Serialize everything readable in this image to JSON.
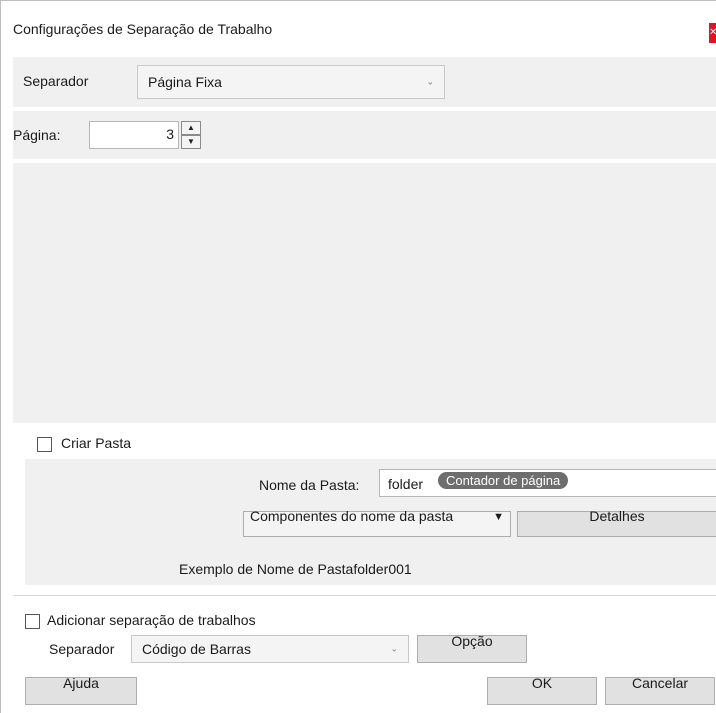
{
  "window": {
    "title": "Configurações de Separação de Trabalho",
    "close_label": "✕"
  },
  "separator": {
    "label": "Separador",
    "value": "Página Fixa"
  },
  "page": {
    "label": "Página:",
    "value": "3"
  },
  "create_folder": {
    "label": "Criar Pasta",
    "checked": false
  },
  "folder_name": {
    "label": "Nome da Pasta:",
    "value": "folder",
    "token": "Contador de página"
  },
  "components": {
    "label": "Componentes do nome da pasta",
    "arrow": "▼"
  },
  "details": {
    "label": "Detalhes"
  },
  "example": {
    "text": "Exemplo de Nome de Pastafolder001"
  },
  "add_job_separation": {
    "label": "Adicionar separação de trabalhos",
    "checked": false
  },
  "separator2": {
    "label": "Separador",
    "value": "Código de Barras"
  },
  "option_button": {
    "label": "Opção"
  },
  "footer": {
    "help": "Ajuda",
    "ok": "OK",
    "cancel": "Cancelar"
  },
  "icons": {
    "chevron": "⌄",
    "up": "▲",
    "down": "▼"
  }
}
